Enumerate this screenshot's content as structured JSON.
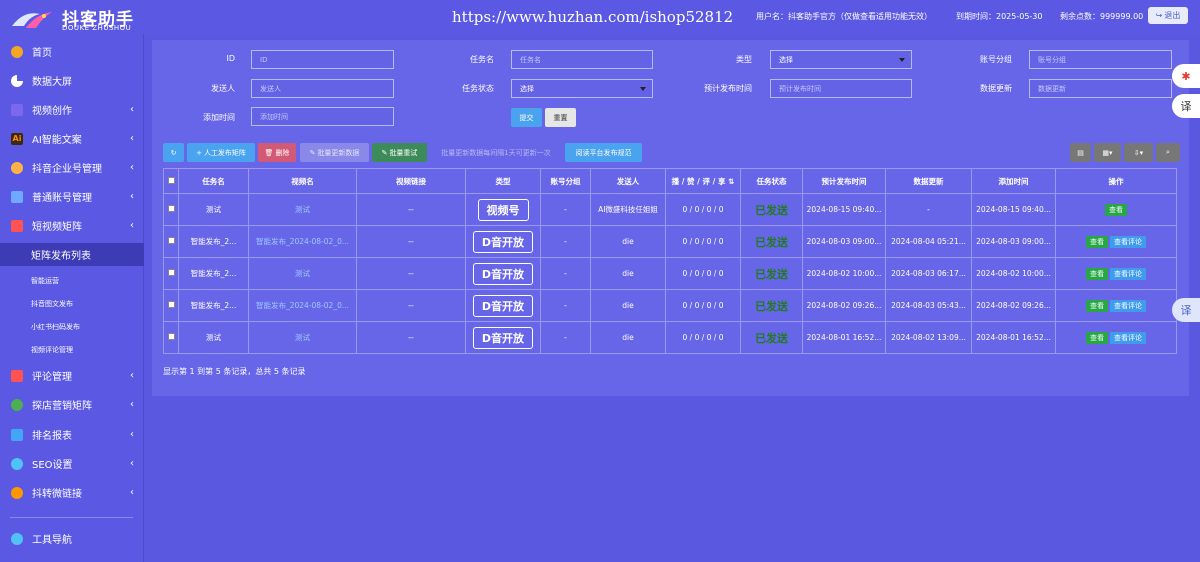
{
  "header": {
    "logo_title": "抖客助手",
    "logo_sub": "DOUKE ZHUSHOU",
    "watermark": "https://www.huzhan.com/ishop52812",
    "user": "用户名：抖客助手官方（仅做查看适用功能无效）",
    "expire": "到期时间：2025-05-30",
    "points": "剩余点数：999999.00",
    "logout": "退出"
  },
  "sidebar": {
    "items": [
      {
        "label": "首页",
        "icon": "home-icon",
        "color": "#f5a623"
      },
      {
        "label": "数据大屏",
        "icon": "pie-chart-icon",
        "color": "#ffffff"
      },
      {
        "label": "视频创作",
        "icon": "video-icon",
        "color": "#7b68ee"
      },
      {
        "label": "AI智能文案",
        "icon": "ai-icon",
        "color": "#ff8c00"
      },
      {
        "label": "抖音企业号管理",
        "icon": "enterprise-icon",
        "color": "#ffb347"
      },
      {
        "label": "普通账号管理",
        "icon": "account-icon",
        "color": "#6fa8ff"
      },
      {
        "label": "短视频矩阵",
        "icon": "matrix-icon",
        "color": "#ff5252"
      }
    ],
    "sub_items": [
      "矩阵发布列表",
      "智能运营",
      "抖音图文发布",
      "小红书扫码发布",
      "视频评论管理"
    ],
    "items2": [
      {
        "label": "评论管理",
        "icon": "comment-icon",
        "color": "#ff5252"
      },
      {
        "label": "探店营销矩阵",
        "icon": "shop-icon",
        "color": "#4caf50"
      },
      {
        "label": "排名报表",
        "icon": "report-icon",
        "color": "#42a5f5"
      },
      {
        "label": "SEO设置",
        "icon": "seo-icon",
        "color": "#4fc3f7"
      },
      {
        "label": "抖转微链接",
        "icon": "link-icon",
        "color": "#ff9800"
      }
    ],
    "tool": {
      "label": "工具导航",
      "icon": "tool-icon",
      "color": "#4fc3f7"
    }
  },
  "filters": {
    "id_label": "ID",
    "id_placeholder": "ID",
    "task_label": "任务名",
    "task_placeholder": "任务名",
    "type_label": "类型",
    "type_value": "选择",
    "group_label": "账号分组",
    "group_placeholder": "账号分组",
    "sender_label": "发送人",
    "sender_placeholder": "发送人",
    "status_label": "任务状态",
    "status_value": "选择",
    "publish_label": "预计发布时间",
    "publish_placeholder": "预计发布时间",
    "update_label": "数据更新",
    "update_placeholder": "数据更新",
    "add_label": "添加时间",
    "add_placeholder": "添加时间",
    "submit": "提交",
    "reset": "重置"
  },
  "toolbar": {
    "manual": "人工发布矩阵",
    "delete": "删除",
    "batch_update": "批量更新数据",
    "batch_retry": "批量重试",
    "note": "批量更新数据每间隔1天可更新一次",
    "read_rules": "阅读平台发布规范"
  },
  "table": {
    "headers": [
      "任务名",
      "视频名",
      "视频链接",
      "类型",
      "账号分组",
      "发送人",
      "播 / 赞 / 评 / 享",
      "任务状态",
      "预计发布时间",
      "数据更新",
      "添加时间",
      "操作"
    ],
    "rows": [
      {
        "task": "测试",
        "video": "测试",
        "link": "--",
        "type": "视频号",
        "group": "-",
        "sender": "AI微盛科技任姐姐",
        "stats": "0 / 0 / 0 / 0",
        "status": "已发送",
        "publish": "2024-08-15 09:40...",
        "update": "-",
        "added": "2024-08-15 09:40...",
        "ops": [
          "查看"
        ]
      },
      {
        "task": "智能发布_2...",
        "video": "智能发布_2024-08-02_0...",
        "link": "--",
        "type": "D音开放",
        "group": "-",
        "sender": "die",
        "stats": "0 / 0 / 0 / 0",
        "status": "已发送",
        "publish": "2024-08-03 09:00...",
        "update": "2024-08-04 05:21...",
        "added": "2024-08-03 09:00...",
        "ops": [
          "查看",
          "查看评论"
        ]
      },
      {
        "task": "智能发布_2...",
        "video": "测试",
        "link": "--",
        "type": "D音开放",
        "group": "-",
        "sender": "die",
        "stats": "0 / 0 / 0 / 0",
        "status": "已发送",
        "publish": "2024-08-02 10:00...",
        "update": "2024-08-03 06:17...",
        "added": "2024-08-02 10:00...",
        "ops": [
          "查看",
          "查看评论"
        ]
      },
      {
        "task": "智能发布_2...",
        "video": "智能发布_2024-08-02_0...",
        "link": "--",
        "type": "D音开放",
        "group": "-",
        "sender": "die",
        "stats": "0 / 0 / 0 / 0",
        "status": "已发送",
        "publish": "2024-08-02 09:26...",
        "update": "2024-08-03 05:43...",
        "added": "2024-08-02 09:26...",
        "ops": [
          "查看",
          "查看评论"
        ]
      },
      {
        "task": "测试",
        "video": "测试",
        "link": "--",
        "type": "D音开放",
        "group": "-",
        "sender": "die",
        "stats": "0 / 0 / 0 / 0",
        "status": "已发送",
        "publish": "2024-08-01 16:52...",
        "update": "2024-08-02 13:09...",
        "added": "2024-08-01 16:52...",
        "ops": [
          "查看",
          "查看评论"
        ]
      }
    ]
  },
  "pager": "显示第 1 到第 5 条记录，总共 5 条记录",
  "float": {
    "translate": "译",
    "translate2": "译"
  }
}
